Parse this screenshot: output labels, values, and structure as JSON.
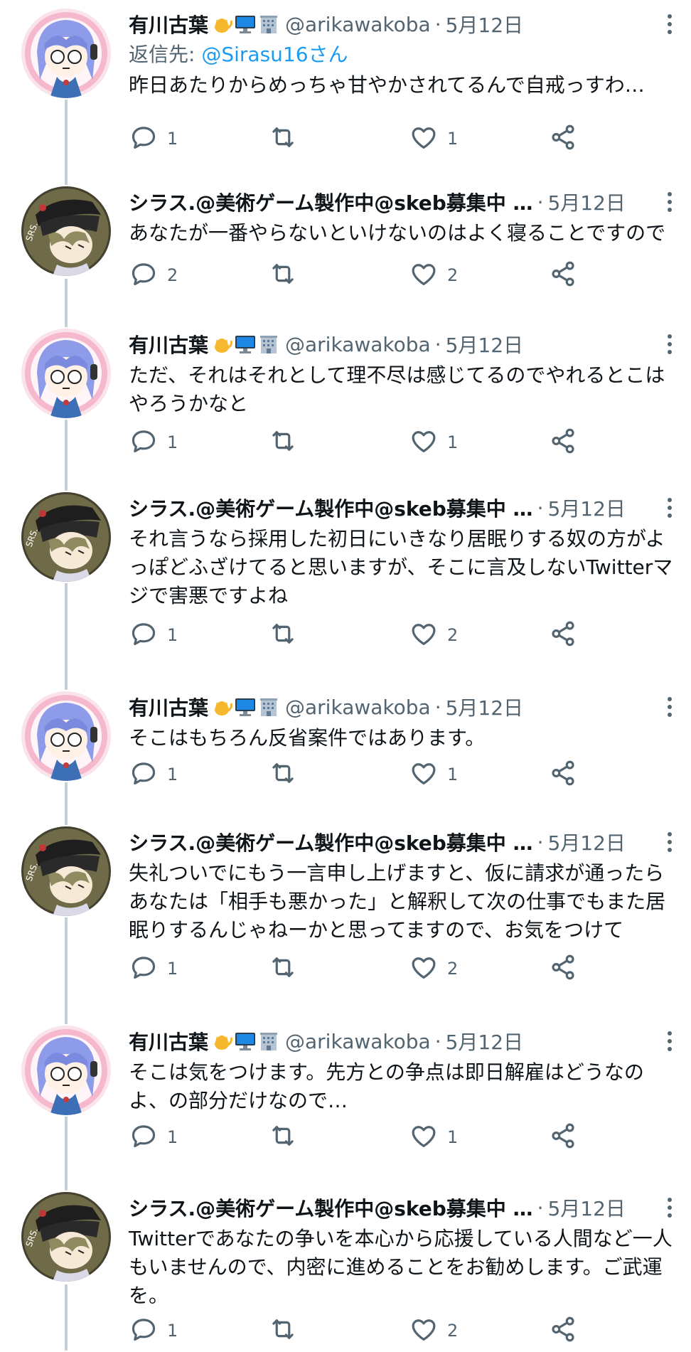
{
  "tweets": [
    {
      "author": "有川古葉",
      "has_emoji": true,
      "handle": "@arikawakoba",
      "date": "5月12日",
      "reply_prefix": "返信先: ",
      "reply_to": "@Sirasu16さん",
      "text": "昨日あたりからめっちゃ甘やかされてるんで自戒っすわ…",
      "replies": "1",
      "retweets": "",
      "likes": "1",
      "avatar": "blue-hair-girl"
    },
    {
      "author": "シラス.@美術ゲーム製作中@skeb募集中 …",
      "has_emoji": false,
      "handle": "",
      "date": "5月12日",
      "text": "あなたが一番やらないといけないのはよく寝ることですので",
      "replies": "2",
      "retweets": "",
      "likes": "2",
      "avatar": "srs-character"
    },
    {
      "author": "有川古葉",
      "has_emoji": true,
      "handle": "@arikawakoba",
      "date": "5月12日",
      "text": "ただ、それはそれとして理不尽は感じてるのでやれるとこはやろうかなと",
      "replies": "1",
      "retweets": "",
      "likes": "1",
      "avatar": "blue-hair-girl"
    },
    {
      "author": "シラス.@美術ゲーム製作中@skeb募集中 …",
      "has_emoji": false,
      "handle": "",
      "date": "5月12日",
      "text": "それ言うなら採用した初日にいきなり居眠りする奴の方がよっぽどふざけてると思いますが、そこに言及しないTwitterマジで害悪ですよね",
      "replies": "1",
      "retweets": "",
      "likes": "2",
      "avatar": "srs-character"
    },
    {
      "author": "有川古葉",
      "has_emoji": true,
      "handle": "@arikawakoba",
      "date": "5月12日",
      "text": "そこはもちろん反省案件ではあります。",
      "replies": "1",
      "retweets": "",
      "likes": "1",
      "avatar": "blue-hair-girl"
    },
    {
      "author": "シラス.@美術ゲーム製作中@skeb募集中 …",
      "has_emoji": false,
      "handle": "",
      "date": "5月12日",
      "text": "失礼ついでにもう一言申し上げますと、仮に請求が通ったらあなたは「相手も悪かった」と解釈して次の仕事でもまた居眠りするんじゃねーかと思ってますので、お気をつけて",
      "replies": "1",
      "retweets": "",
      "likes": "2",
      "avatar": "srs-character"
    },
    {
      "author": "有川古葉",
      "has_emoji": true,
      "handle": "@arikawakoba",
      "date": "5月12日",
      "text": "そこは気をつけます。先方との争点は即日解雇はどうなのよ、の部分だけなので…",
      "replies": "1",
      "retweets": "",
      "likes": "1",
      "avatar": "blue-hair-girl"
    },
    {
      "author": "シラス.@美術ゲーム製作中@skeb募集中 …",
      "has_emoji": false,
      "handle": "",
      "date": "5月12日",
      "text": "Twitterであなたの争いを本心から応援している人間など一人もいませんので、内密に進めることをお勧めします。ご武運を。",
      "replies": "1",
      "retweets": "",
      "likes": "2",
      "avatar": "srs-character"
    }
  ],
  "icons": {
    "reply": "reply-icon",
    "retweet": "retweet-icon",
    "like": "heart-icon",
    "share": "share-icon",
    "more": "more-vertical-icon"
  },
  "colors": {
    "accent": "#1d9bf0",
    "secondary_text": "#536471",
    "thread_line": "#c4cfd6"
  }
}
